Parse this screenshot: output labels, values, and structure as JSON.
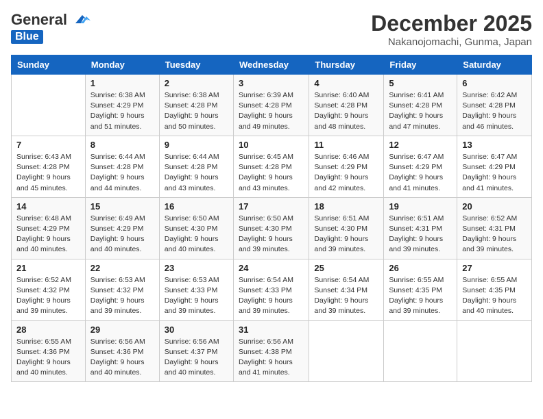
{
  "header": {
    "logo_general": "General",
    "logo_blue": "Blue",
    "month": "December 2025",
    "location": "Nakanojomachi, Gunma, Japan"
  },
  "weekdays": [
    "Sunday",
    "Monday",
    "Tuesday",
    "Wednesday",
    "Thursday",
    "Friday",
    "Saturday"
  ],
  "weeks": [
    [
      {
        "day": "",
        "info": ""
      },
      {
        "day": "1",
        "info": "Sunrise: 6:38 AM\nSunset: 4:29 PM\nDaylight: 9 hours\nand 51 minutes."
      },
      {
        "day": "2",
        "info": "Sunrise: 6:38 AM\nSunset: 4:28 PM\nDaylight: 9 hours\nand 50 minutes."
      },
      {
        "day": "3",
        "info": "Sunrise: 6:39 AM\nSunset: 4:28 PM\nDaylight: 9 hours\nand 49 minutes."
      },
      {
        "day": "4",
        "info": "Sunrise: 6:40 AM\nSunset: 4:28 PM\nDaylight: 9 hours\nand 48 minutes."
      },
      {
        "day": "5",
        "info": "Sunrise: 6:41 AM\nSunset: 4:28 PM\nDaylight: 9 hours\nand 47 minutes."
      },
      {
        "day": "6",
        "info": "Sunrise: 6:42 AM\nSunset: 4:28 PM\nDaylight: 9 hours\nand 46 minutes."
      }
    ],
    [
      {
        "day": "7",
        "info": "Sunrise: 6:43 AM\nSunset: 4:28 PM\nDaylight: 9 hours\nand 45 minutes."
      },
      {
        "day": "8",
        "info": "Sunrise: 6:44 AM\nSunset: 4:28 PM\nDaylight: 9 hours\nand 44 minutes."
      },
      {
        "day": "9",
        "info": "Sunrise: 6:44 AM\nSunset: 4:28 PM\nDaylight: 9 hours\nand 43 minutes."
      },
      {
        "day": "10",
        "info": "Sunrise: 6:45 AM\nSunset: 4:28 PM\nDaylight: 9 hours\nand 43 minutes."
      },
      {
        "day": "11",
        "info": "Sunrise: 6:46 AM\nSunset: 4:29 PM\nDaylight: 9 hours\nand 42 minutes."
      },
      {
        "day": "12",
        "info": "Sunrise: 6:47 AM\nSunset: 4:29 PM\nDaylight: 9 hours\nand 41 minutes."
      },
      {
        "day": "13",
        "info": "Sunrise: 6:47 AM\nSunset: 4:29 PM\nDaylight: 9 hours\nand 41 minutes."
      }
    ],
    [
      {
        "day": "14",
        "info": "Sunrise: 6:48 AM\nSunset: 4:29 PM\nDaylight: 9 hours\nand 40 minutes."
      },
      {
        "day": "15",
        "info": "Sunrise: 6:49 AM\nSunset: 4:29 PM\nDaylight: 9 hours\nand 40 minutes."
      },
      {
        "day": "16",
        "info": "Sunrise: 6:50 AM\nSunset: 4:30 PM\nDaylight: 9 hours\nand 40 minutes."
      },
      {
        "day": "17",
        "info": "Sunrise: 6:50 AM\nSunset: 4:30 PM\nDaylight: 9 hours\nand 39 minutes."
      },
      {
        "day": "18",
        "info": "Sunrise: 6:51 AM\nSunset: 4:30 PM\nDaylight: 9 hours\nand 39 minutes."
      },
      {
        "day": "19",
        "info": "Sunrise: 6:51 AM\nSunset: 4:31 PM\nDaylight: 9 hours\nand 39 minutes."
      },
      {
        "day": "20",
        "info": "Sunrise: 6:52 AM\nSunset: 4:31 PM\nDaylight: 9 hours\nand 39 minutes."
      }
    ],
    [
      {
        "day": "21",
        "info": "Sunrise: 6:52 AM\nSunset: 4:32 PM\nDaylight: 9 hours\nand 39 minutes."
      },
      {
        "day": "22",
        "info": "Sunrise: 6:53 AM\nSunset: 4:32 PM\nDaylight: 9 hours\nand 39 minutes."
      },
      {
        "day": "23",
        "info": "Sunrise: 6:53 AM\nSunset: 4:33 PM\nDaylight: 9 hours\nand 39 minutes."
      },
      {
        "day": "24",
        "info": "Sunrise: 6:54 AM\nSunset: 4:33 PM\nDaylight: 9 hours\nand 39 minutes."
      },
      {
        "day": "25",
        "info": "Sunrise: 6:54 AM\nSunset: 4:34 PM\nDaylight: 9 hours\nand 39 minutes."
      },
      {
        "day": "26",
        "info": "Sunrise: 6:55 AM\nSunset: 4:35 PM\nDaylight: 9 hours\nand 39 minutes."
      },
      {
        "day": "27",
        "info": "Sunrise: 6:55 AM\nSunset: 4:35 PM\nDaylight: 9 hours\nand 40 minutes."
      }
    ],
    [
      {
        "day": "28",
        "info": "Sunrise: 6:55 AM\nSunset: 4:36 PM\nDaylight: 9 hours\nand 40 minutes."
      },
      {
        "day": "29",
        "info": "Sunrise: 6:56 AM\nSunset: 4:36 PM\nDaylight: 9 hours\nand 40 minutes."
      },
      {
        "day": "30",
        "info": "Sunrise: 6:56 AM\nSunset: 4:37 PM\nDaylight: 9 hours\nand 40 minutes."
      },
      {
        "day": "31",
        "info": "Sunrise: 6:56 AM\nSunset: 4:38 PM\nDaylight: 9 hours\nand 41 minutes."
      },
      {
        "day": "",
        "info": ""
      },
      {
        "day": "",
        "info": ""
      },
      {
        "day": "",
        "info": ""
      }
    ]
  ]
}
